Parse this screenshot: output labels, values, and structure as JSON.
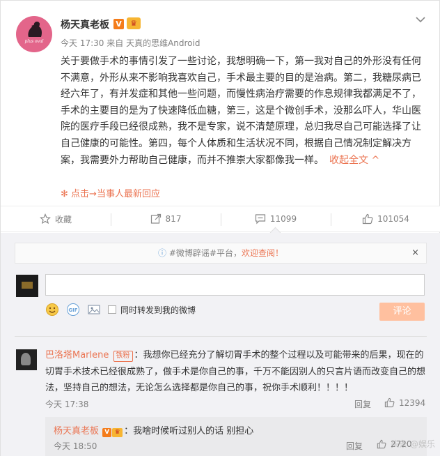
{
  "post": {
    "author": "杨天真老板",
    "verified_badge": "V",
    "crown_badge": "♛",
    "time": "今天 17:30",
    "source_prefix": "来自",
    "source": "天真的思维Android",
    "avatar_text": "plus oval",
    "text": "关于要做手术的事情引发了一些讨论，我想明确一下，第一我对自己的外形没有任何不满意，外形从来不影响我喜欢自己，手术最主要的目的是治病。第二，我糖尿病已经六年了，有并发症和其他一些问题，而慢性病治疗需要的作息规律我都满足不了，手术的主要目的是为了快速降低血糖，第三，这是个微创手术，没那么吓人，华山医院的医疗手段已经很成熟，我不是专家，说不清楚原理，总归我尽自己可能选择了让自己健康的可能性。第四，每个人体质和生活状况不同，根据自己情况制定解决方案，我需要外力帮助自己健康，而并不推崇大家都像我一样。",
    "collapse_label": "收起全文 ^",
    "hot_reply": "点击→当事人最新回应",
    "menu_icon": "chevron-down-icon"
  },
  "actions": {
    "favorite": "收藏",
    "repost": "817",
    "comment": "11099",
    "like": "101054"
  },
  "comment_box": {
    "notice_prefix": "#微博辟谣#平台，",
    "notice_link": "欢迎查阅！",
    "notice_close": "×",
    "forward_label": "同时转发到我的微博",
    "submit_label": "评论"
  },
  "comments": [
    {
      "nick": "巴洛塔Marlene",
      "fan_badge": "铁粉",
      "text": "：我想你已经充分了解切胃手术的整个过程以及可能带来的后果，现在的切胃手术技术已经很成熟了，做手术是你自己的事，千万不能因别人的只言片语而改变自己的想法，坚持自己的想法，无论怎么选择都是你自己的事，祝你手术顺利！！！！",
      "time": "今天 17:38",
      "reply_label": "回复",
      "likes": "12394",
      "replies": [
        {
          "nick": "杨天真老板",
          "verified_badge": "V",
          "crown_badge": "♛",
          "text": "：我啥时候听过别人的话 别担心",
          "time": "今天 18:50",
          "reply_label": "回复",
          "likes": "2720"
        }
      ]
    }
  ],
  "watermark": "头条 @娱乐"
}
